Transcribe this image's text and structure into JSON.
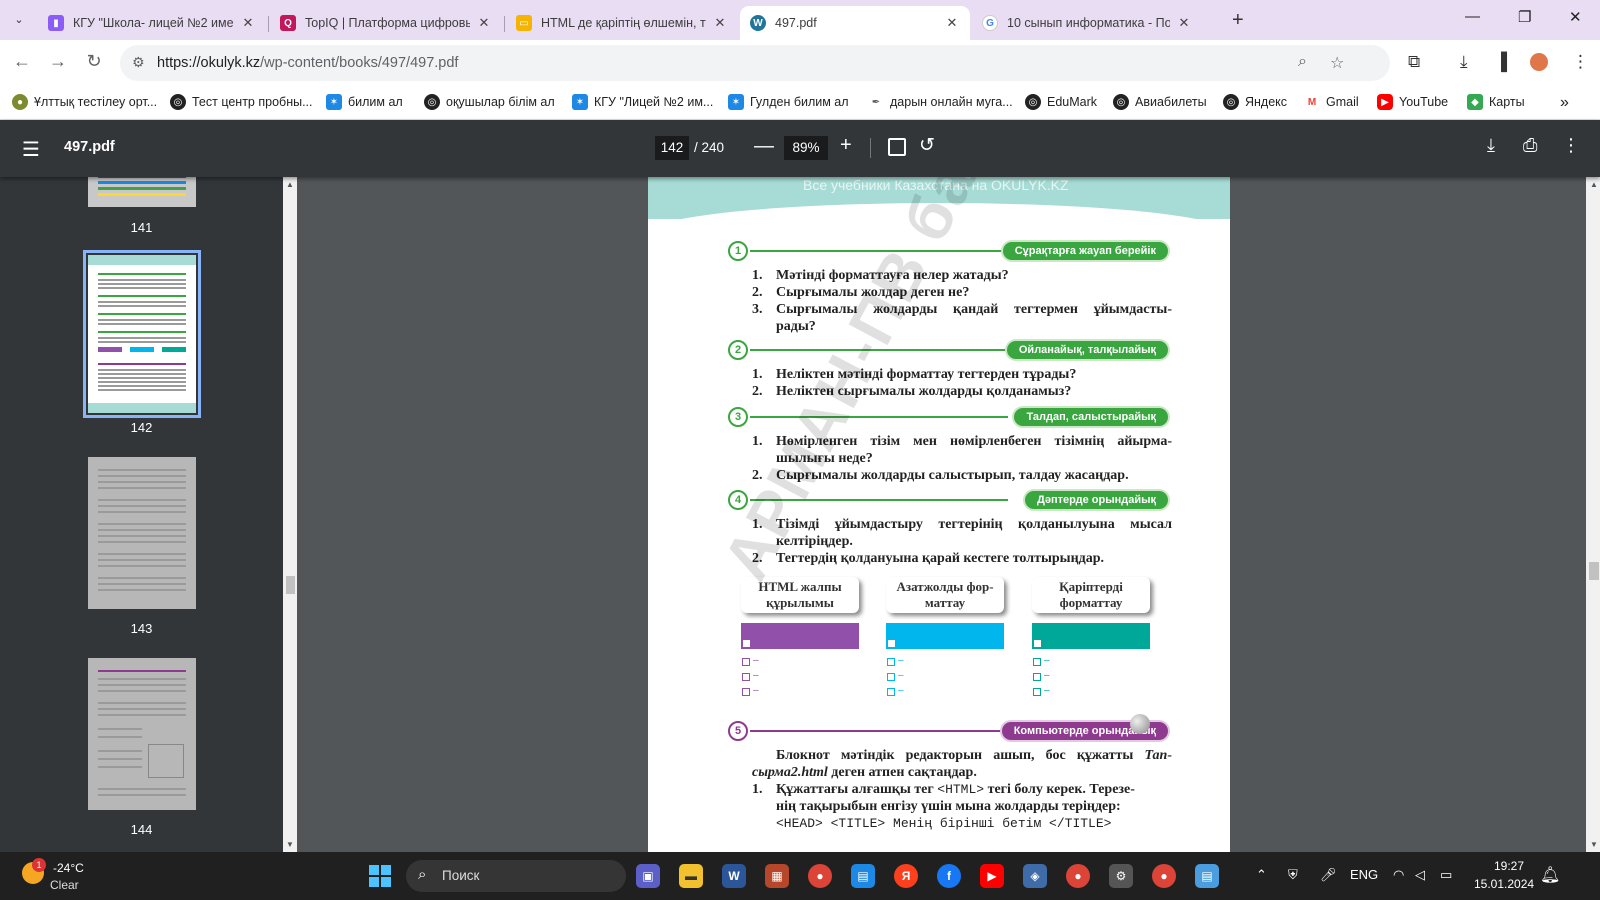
{
  "browser": {
    "tabs": [
      {
        "title": "КГУ \"Школа- лицей №2 имени",
        "favicon": "school-favicon",
        "color": "#8b5cf6",
        "active": false
      },
      {
        "title": "TopIQ | Платформа цифровых",
        "favicon": "topiq-favicon",
        "color": "#c2185b",
        "active": false
      },
      {
        "title": "HTML де қаріптің өлшемін, тү",
        "favicon": "slides-favicon",
        "color": "#f4b400",
        "active": false
      },
      {
        "title": "497.pdf",
        "favicon": "wordpress-favicon",
        "color": "#21759b",
        "active": true
      },
      {
        "title": "10 сынып информатика - Пои",
        "favicon": "google-favicon",
        "color": "#4285f4",
        "active": false
      }
    ],
    "url_host": "https://okulyk.kz",
    "url_path": "/wp-content/books/497/497.pdf",
    "bookmarks": [
      {
        "label": "Ұлттық тестілеу орт...",
        "icon": "globe-icon",
        "color": "#7b8b2e"
      },
      {
        "label": "Тест центр пробны...",
        "icon": "globe-icon",
        "color": "#222"
      },
      {
        "label": "билим ал",
        "icon": "bilimal-icon",
        "color": "#1e88e5"
      },
      {
        "label": "оқушылар білім ал",
        "icon": "globe-icon",
        "color": "#222"
      },
      {
        "label": "КГУ \"Лицей №2 им...",
        "icon": "bilimal-icon",
        "color": "#1e88e5"
      },
      {
        "label": "Гулден билим ал",
        "icon": "bilimal-icon",
        "color": "#1e88e5"
      },
      {
        "label": "дарын онлайн муга...",
        "icon": "feather-icon",
        "color": "#555"
      },
      {
        "label": "EduMark",
        "icon": "globe-icon",
        "color": "#222"
      },
      {
        "label": "Авиабилеты",
        "icon": "globe-icon",
        "color": "#222"
      },
      {
        "label": "Яндекс",
        "icon": "globe-icon",
        "color": "#222"
      },
      {
        "label": "Gmail",
        "icon": "gmail-icon",
        "color": "#ea4335"
      },
      {
        "label": "YouTube",
        "icon": "youtube-icon",
        "color": "#ff0000"
      },
      {
        "label": "Карты",
        "icon": "maps-icon",
        "color": "#34a853"
      }
    ]
  },
  "pdf": {
    "name": "497.pdf",
    "current_page": "142",
    "total": "/ 240",
    "zoom": "89%",
    "thumbnails": [
      "141",
      "142",
      "143",
      "144"
    ]
  },
  "page": {
    "header_text": "Все учебники Казахстана на OKULYK.KZ",
    "watermark": "АРМАН-ПВ баспасы",
    "sections": [
      {
        "num": "1",
        "label": "Сұрақтарға жауап берейік"
      },
      {
        "num": "2",
        "label": "Ойланайық, талқылайық"
      },
      {
        "num": "3",
        "label": "Талдап, салыстырайық"
      },
      {
        "num": "4",
        "label": "Дәптерде орындайық"
      },
      {
        "num": "5",
        "label": "Компьютерде орындайық"
      }
    ],
    "s1": [
      {
        "n": "1.",
        "t": "Мәтінді форматтауға нелер жатады?"
      },
      {
        "n": "2.",
        "t": "Сырғымалы жолдар деген не?"
      },
      {
        "n": "3.",
        "t": "Сырғымалы жолдарды қандай тегтермен ұйымдасты-"
      },
      {
        "n": "",
        "t": "рады?"
      }
    ],
    "s2": [
      {
        "n": "1.",
        "t": "Неліктен мәтінді форматтау тегтерден тұрады?"
      },
      {
        "n": "2.",
        "t": "Неліктен сырғымалы жолдарды қолданамыз?"
      }
    ],
    "s3": [
      {
        "n": "1.",
        "t": "Нөмірленген тізім мен нөмірленбеген тізімнің айырма-"
      },
      {
        "n": "",
        "t": "шылығы неде?"
      },
      {
        "n": "2.",
        "t": "Сырғымалы жолдарды салыстырып, талдау жасаңдар."
      }
    ],
    "s4": [
      {
        "n": "1.",
        "t": "Тізімді ұйымдастыру тегтерінің қолданылуына мысал"
      },
      {
        "n": "",
        "t": "келтіріңдер."
      },
      {
        "n": "2.",
        "t": "Тегтердің қолдануына қарай кестеге толтырыңдар."
      }
    ],
    "cards": [
      {
        "line1": "HTML жалпы",
        "line2": "құрылымы",
        "color": "#9150a9"
      },
      {
        "line1": "Азатжолды фор-",
        "line2": "маттау",
        "color": "#00b6ec"
      },
      {
        "line1": "Қаріптерді",
        "line2": "форматтау",
        "color": "#00a89a"
      }
    ],
    "s5_intro_1": "Блокнот мәтіндік редакторын ашып, бос құжатты",
    "s5_intro_italic": "Тап-",
    "s5_intro_2_italic": "сырма2.html",
    "s5_intro_2": " деген атпен сақтаңдар.",
    "s5_item_n": "1.",
    "s5_item_1a": "Құжаттағы алғашқы тег",
    "s5_item_tag": "<HTML>",
    "s5_item_1b": "тегі болу керек. Терезе-",
    "s5_item_2": "нің тақырыбын енгізу үшін мына жолдарды теріңдер:",
    "s5_code": "<HEAD> <TITLE> Менің бірінші бетім </TITLE>"
  },
  "taskbar": {
    "temp": "-24°C",
    "condition": "Clear",
    "weather_badge": "1",
    "search_placeholder": "Поиск",
    "lang": "ENG",
    "time": "19:27",
    "date": "15.01.2024"
  }
}
